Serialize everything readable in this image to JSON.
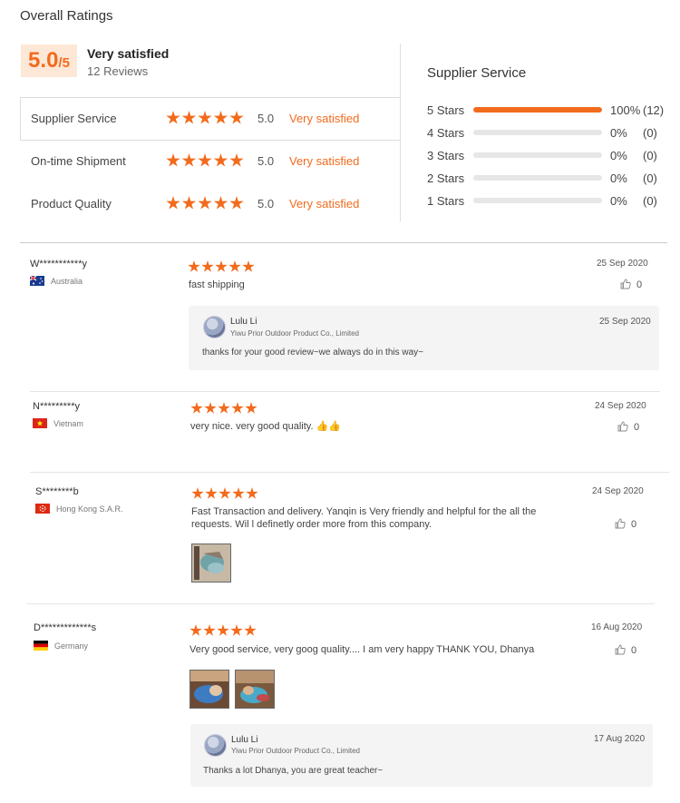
{
  "summary": {
    "title": "Overall Ratings",
    "score": "5.0",
    "score_suffix": "/5",
    "satisfaction": "Very satisfied",
    "reviews": "12 Reviews"
  },
  "categories": [
    {
      "name": "Supplier Service",
      "score": "5.0",
      "status": "Very satisfied",
      "stars": 5
    },
    {
      "name": "On-time Shipment",
      "score": "5.0",
      "status": "Very satisfied",
      "stars": 5
    },
    {
      "name": "Product Quality",
      "score": "5.0",
      "status": "Very satisfied",
      "stars": 5
    }
  ],
  "breakdown": {
    "title": "Supplier Service",
    "rows": [
      {
        "label": "5 Stars",
        "pct": "100%",
        "count": "(12)",
        "fill": 1.0
      },
      {
        "label": "4 Stars",
        "pct": "0%",
        "count": "(0)",
        "fill": 0
      },
      {
        "label": "3 Stars",
        "pct": "0%",
        "count": "(0)",
        "fill": 0
      },
      {
        "label": "2 Stars",
        "pct": "0%",
        "count": "(0)",
        "fill": 0
      },
      {
        "label": "1 Stars",
        "pct": "0%",
        "count": "(0)",
        "fill": 0
      }
    ]
  },
  "reviews": [
    {
      "user": "W***********y",
      "country": "Australia",
      "flag": "au",
      "stars": 5,
      "text": "fast shipping",
      "date": "25 Sep 2020",
      "likes": "0",
      "reply": {
        "name": "Lulu Li",
        "company": "Yiwu Prior Outdoor Product Co., Limited",
        "date": "25 Sep 2020",
        "text": "thanks for your good review~we always do in this way~"
      }
    },
    {
      "user": "N*********y",
      "country": "Vietnam",
      "flag": "vn",
      "stars": 5,
      "text": "very nice. very good quality. 👍👍",
      "date": "24 Sep 2020",
      "likes": "0"
    },
    {
      "user": "S********b",
      "country": "Hong Kong S.A.R.",
      "flag": "hk",
      "stars": 5,
      "text": "Fast Transaction and delivery. Yanqin is  Very friendly and helpful for the all the requests. Wil l definetly order more from this company.",
      "date": "24 Sep 2020",
      "likes": "0"
    },
    {
      "user": "D*************s",
      "country": "Germany",
      "flag": "de",
      "stars": 5,
      "text": "Very good service, very goog quality.... I am very happy THANK YOU, Dhanya",
      "date": "16 Aug 2020",
      "likes": "0",
      "reply": {
        "name": "Lulu Li",
        "company": "Yiwu Prior Outdoor Product Co., Limited",
        "date": "17 Aug 2020",
        "text": "Thanks a lot Dhanya, you are great teacher~"
      }
    }
  ],
  "colors": {
    "accent": "#f26b1d",
    "bar_track": "#e6e6e6",
    "reply_bg": "#f4f4f5"
  }
}
